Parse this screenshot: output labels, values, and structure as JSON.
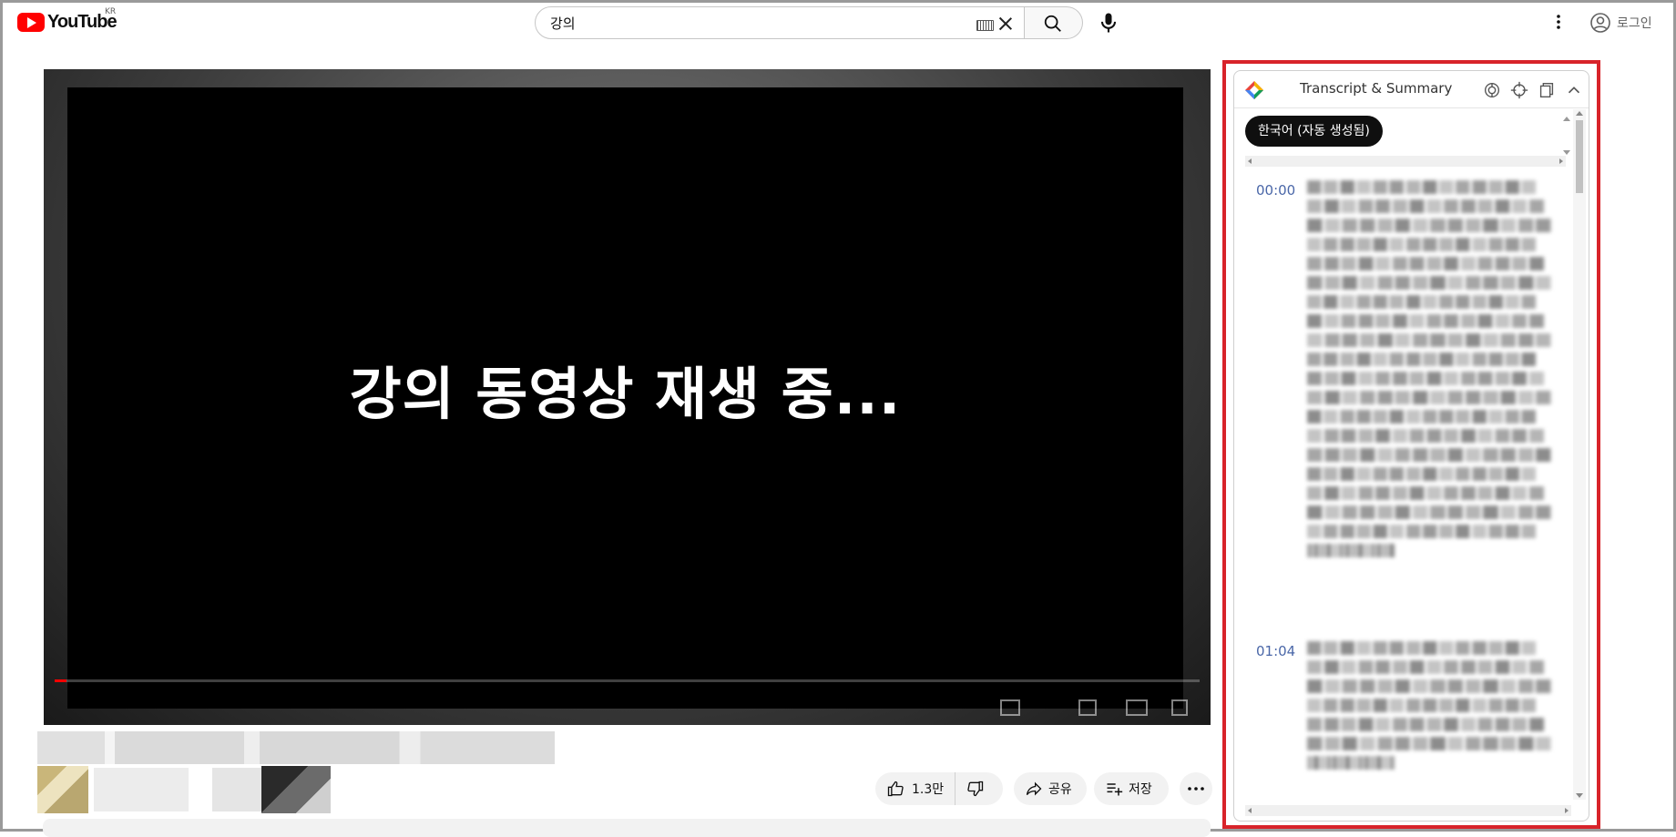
{
  "header": {
    "logo_text": "YouTube",
    "country_code": "KR",
    "search_value": "강의",
    "login_label": "로그인"
  },
  "video": {
    "overlay_text": "강의 동영상 재생 중...",
    "progress": 0.01
  },
  "actions": {
    "likes": "1.3만",
    "share_label": "공유",
    "save_label": "저장"
  },
  "panel": {
    "title": "Transcript & Summary",
    "language_chip": "한국어 (자동 생성됨)",
    "segments": [
      {
        "time": "00:00"
      },
      {
        "time": "01:04"
      }
    ]
  },
  "colors": {
    "brand_red": "#ff0000",
    "highlight_frame": "#d8232a",
    "timestamp_blue": "#4a67a8"
  }
}
